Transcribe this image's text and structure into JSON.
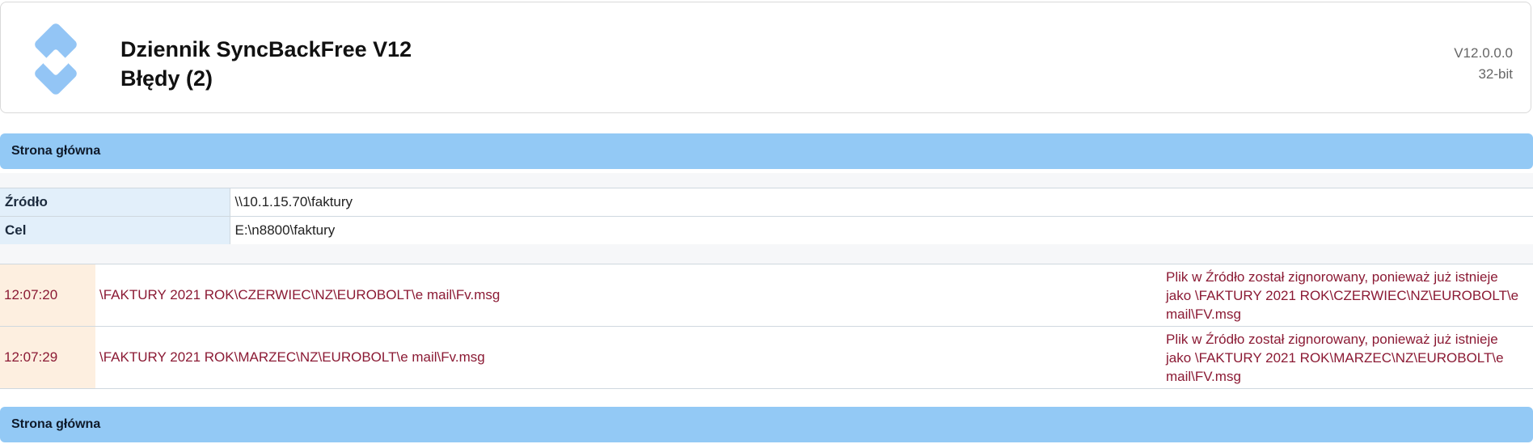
{
  "header": {
    "title": "Dziennik SyncBackFree V12",
    "subtitle": "Błędy (2)",
    "version": "V12.0.0.0",
    "bitness": "32-bit",
    "logo_icon": "syncback-diamond-logo",
    "logo_color": "#93c5f5"
  },
  "nav_top": {
    "label": "Strona główna"
  },
  "nav_bottom": {
    "label": "Strona główna"
  },
  "info": {
    "rows": [
      {
        "label": "Źródło",
        "value": "\\\\10.1.15.70\\faktury"
      },
      {
        "label": "Cel",
        "value": "E:\\n8800\\faktury"
      }
    ]
  },
  "errors": {
    "rows": [
      {
        "time": "12:07:20",
        "path": "\\FAKTURY 2021 ROK\\CZERWIEC\\NZ\\EUROBOLT\\e mail\\Fv.msg",
        "message": "Plik w Źródło został zignorowany, ponieważ już istnieje jako \\FAKTURY 2021 ROK\\CZERWIEC\\NZ\\EUROBOLT\\e mail\\FV.msg"
      },
      {
        "time": "12:07:29",
        "path": "\\FAKTURY 2021 ROK\\MARZEC\\NZ\\EUROBOLT\\e mail\\Fv.msg",
        "message": "Plik w Źródło został zignorowany, ponieważ już istnieje jako \\FAKTURY 2021 ROK\\MARZEC\\NZ\\EUROBOLT\\e mail\\FV.msg"
      }
    ]
  },
  "colors": {
    "nav_bar": "#93c9f5",
    "label_cell": "#e2effa",
    "time_cell": "#fdefe0",
    "error_text": "#8b1a34"
  }
}
